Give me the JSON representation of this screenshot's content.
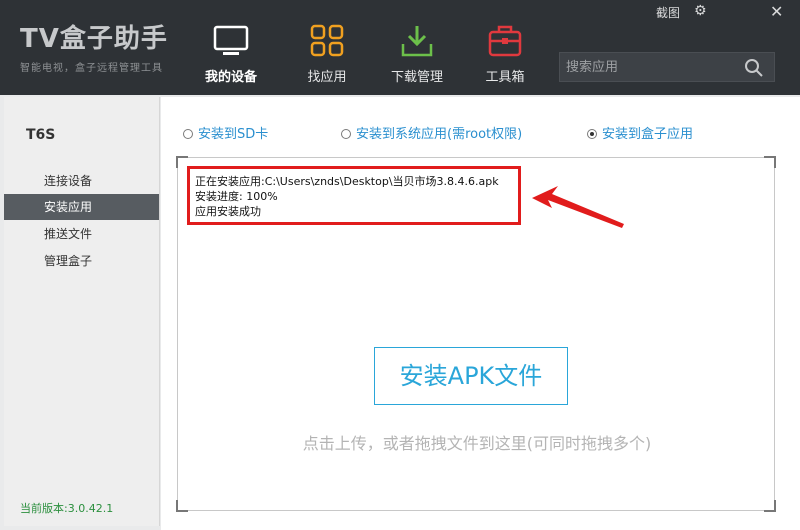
{
  "logo": {
    "title": "TV盒子助手",
    "subtitle": "智能电视，盒子远程管理工具"
  },
  "nav": [
    {
      "label": "我的设备",
      "icon": "monitor-icon",
      "active": true
    },
    {
      "label": "找应用",
      "icon": "grid-icon",
      "active": false
    },
    {
      "label": "下载管理",
      "icon": "download-icon",
      "active": false
    },
    {
      "label": "工具箱",
      "icon": "toolbox-icon",
      "active": false
    }
  ],
  "window": {
    "screenshot_label": "截图",
    "gear": "⚙",
    "close": "✕"
  },
  "search": {
    "placeholder": "搜索应用"
  },
  "sidebar": {
    "device_name": "T6S",
    "items": [
      {
        "label": "连接设备"
      },
      {
        "label": "安装应用"
      },
      {
        "label": "推送文件"
      },
      {
        "label": "管理盒子"
      }
    ],
    "version": "当前版本:3.0.42.1"
  },
  "install_targets": [
    {
      "label": "安装到SD卡",
      "selected": false
    },
    {
      "label": "安装到系统应用(需root权限)",
      "selected": false
    },
    {
      "label": "安装到盒子应用",
      "selected": true
    }
  ],
  "log": {
    "line1": "正在安装应用:C:\\Users\\znds\\Desktop\\当贝市场3.8.4.6.apk",
    "line2": "安装进度:  100%",
    "line3": "应用安装成功"
  },
  "install_button": "安装APK文件",
  "hint": "点击上传，或者拖拽文件到这里(可同时拖拽多个)",
  "colors": {
    "accent": "#2aa6d9",
    "highlight": "#e11c1c",
    "topbar": "#2e3236",
    "version": "#2b8f3e"
  }
}
